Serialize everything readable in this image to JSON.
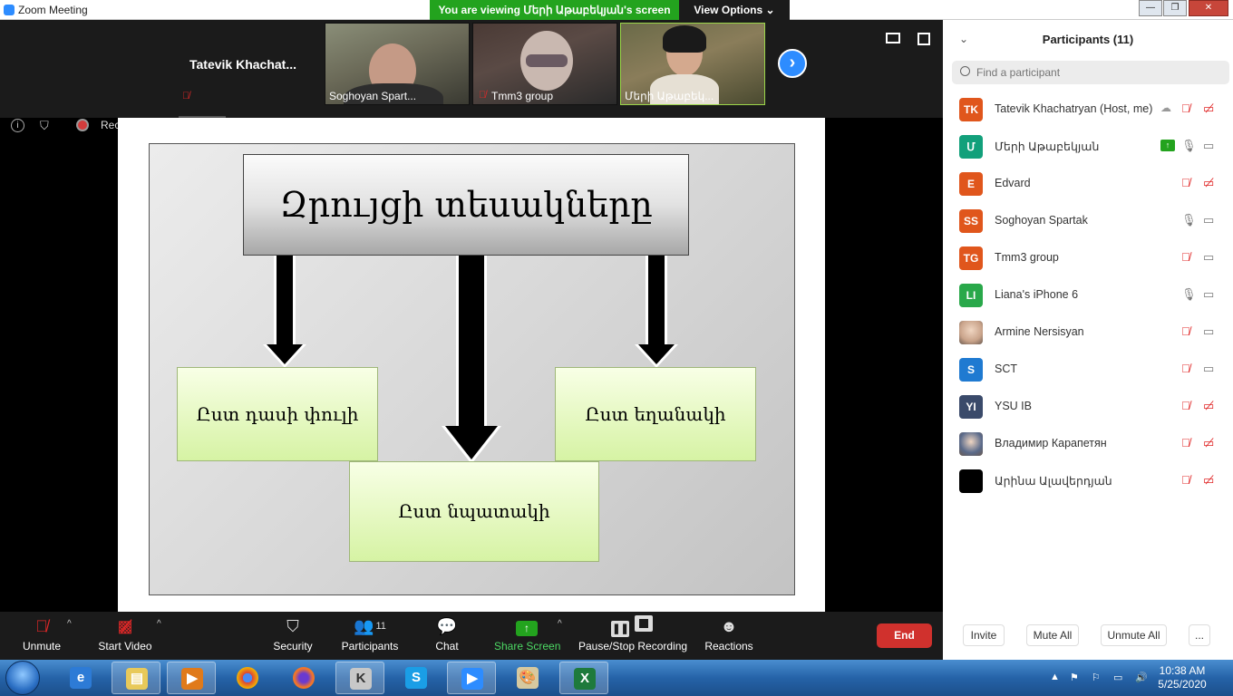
{
  "window": {
    "title": "Zoom Meeting",
    "viewing_banner": "You are viewing Մերի Աթաբեկյան's screen",
    "view_options": "View Options"
  },
  "video_strip": {
    "tiles": [
      {
        "name": "Tatevik  Khachat...",
        "muted": true
      },
      {
        "name": "Soghoyan Spart..."
      },
      {
        "name": "Tmm3 group",
        "muted": true
      },
      {
        "name": "Մերի Աթաբեկ..."
      }
    ]
  },
  "recording": {
    "label": "Recording..."
  },
  "slide": {
    "title": "Զրույցի տեսակները",
    "box_left": "Ըստ դասի փուլի",
    "box_right": "Ըստ եղանակի",
    "box_bottom": "Ըստ նպատակի"
  },
  "participants_panel": {
    "title": "Participants (11)",
    "search_placeholder": "Find a participant",
    "participants": [
      {
        "initials": "TK",
        "name": "Tatevik Khachatryan (Host, me)",
        "color": "#e0561c",
        "mic": "muted",
        "cam": "off",
        "recording_cloud": true
      },
      {
        "initials": "Մ",
        "name": "Մերի Աթաբեկյան",
        "color": "#12a07b",
        "mic": "on",
        "cam": "on",
        "sharing": true
      },
      {
        "initials": "E",
        "name": "Edvard",
        "color": "#e0561c",
        "mic": "muted",
        "cam": "off"
      },
      {
        "initials": "SS",
        "name": "Soghoyan Spartak",
        "color": "#e0561c",
        "mic": "on",
        "cam": "on"
      },
      {
        "initials": "TG",
        "name": "Tmm3 group",
        "color": "#e0561c",
        "mic": "muted",
        "cam": "on"
      },
      {
        "initials": "LI",
        "name": "Liana's iPhone 6",
        "color": "#29a84a",
        "mic": "on",
        "cam": "on"
      },
      {
        "initials": "",
        "name": "Armine Nersisyan",
        "color": "#c9a38a",
        "mic": "muted",
        "cam": "on",
        "photo": true
      },
      {
        "initials": "S",
        "name": "SCT",
        "color": "#1f7ad1",
        "mic": "muted",
        "cam": "on"
      },
      {
        "initials": "YI",
        "name": "YSU IB",
        "color": "#3a4a6a",
        "mic": "muted",
        "cam": "off"
      },
      {
        "initials": "",
        "name": "Владимир Карапетян",
        "color": "#5a6a8a",
        "mic": "muted",
        "cam": "off",
        "photo": true
      },
      {
        "initials": "",
        "name": "Արինա Ալավերդյան",
        "color": "#000000",
        "mic": "muted",
        "cam": "off"
      }
    ],
    "buttons": {
      "invite": "Invite",
      "mute_all": "Mute All",
      "unmute_all": "Unmute All",
      "more": "..."
    }
  },
  "toolbar": {
    "unmute": "Unmute",
    "start_video": "Start Video",
    "security": "Security",
    "participants": "Participants",
    "participants_count": "11",
    "chat": "Chat",
    "share_screen": "Share Screen",
    "pause_stop_recording": "Pause/Stop Recording",
    "reactions": "Reactions",
    "end": "End"
  },
  "taskbar": {
    "apps": [
      "explorer-icon",
      "ie-icon",
      "media-player-icon",
      "chrome-icon",
      "firefox-icon",
      "k-app-icon",
      "skype-icon",
      "zoom-icon",
      "paint-icon",
      "excel-icon"
    ],
    "time": "10:38 AM",
    "date": "5/25/2020"
  }
}
